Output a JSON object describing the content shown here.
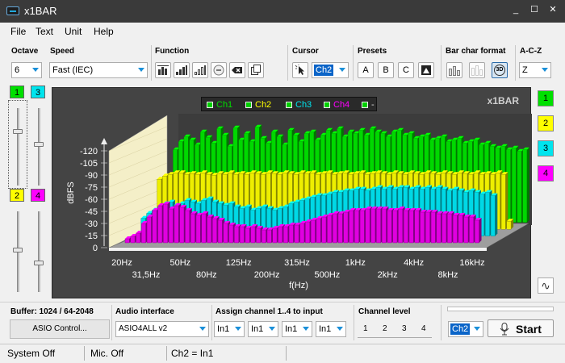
{
  "window": {
    "title": "x1BAR",
    "minimize": "_",
    "maximize": "☐",
    "close": "✕"
  },
  "menu": [
    "File",
    "Text",
    "Unit",
    "Help"
  ],
  "toolbar": {
    "octave": {
      "label": "Octave",
      "value": "6"
    },
    "speed": {
      "label": "Speed",
      "value": "Fast (IEC)"
    },
    "function": {
      "label": "Function",
      "buttons": [
        "peak-hold-icon",
        "bars-icon",
        "bars-outline-icon",
        "stop-icon",
        "clear-icon",
        "copy-icon"
      ]
    },
    "cursor": {
      "label": "Cursor",
      "value": "Ch2"
    },
    "presets": {
      "label": "Presets",
      "buttons": [
        "A",
        "B",
        "C"
      ]
    },
    "bar_format": {
      "label": "Bar char format",
      "view_3d": "3D"
    },
    "weighting": {
      "label": "A-C-Z",
      "value": "Z"
    }
  },
  "left_channels": [
    {
      "label": "1",
      "color": "#00e000"
    },
    {
      "label": "3",
      "color": "#00e5ee"
    },
    {
      "label": "2",
      "color": "#ffff00"
    },
    {
      "label": "4",
      "color": "#ff00ff"
    }
  ],
  "right_channels": [
    {
      "label": "1",
      "color": "#00e000"
    },
    {
      "label": "2",
      "color": "#ffff00"
    },
    {
      "label": "3",
      "color": "#00e5ee"
    },
    {
      "label": "4",
      "color": "#ff00ff"
    }
  ],
  "chart": {
    "brand": "x1BAR",
    "wave_icon": "∿"
  },
  "chart_data": {
    "type": "bar",
    "ylabel": "dBFS",
    "xlabel": "f(Hz)",
    "ylim": [
      -120,
      0
    ],
    "y_ticks": [
      0,
      -15,
      -30,
      -45,
      -60,
      -75,
      -90,
      -105,
      -120
    ],
    "x_ticks_row1": [
      "20Hz",
      "50Hz",
      "125Hz",
      "315Hz",
      "1kHz",
      "4kHz",
      "16kHz"
    ],
    "x_ticks_row2": [
      "31,5Hz",
      "80Hz",
      "200Hz",
      "500Hz",
      "2kHz",
      "8kHz"
    ],
    "legend": [
      {
        "name": "Ch1",
        "color": "#00e000"
      },
      {
        "name": "Ch2",
        "color": "#ffff00"
      },
      {
        "name": "Ch3",
        "color": "#00e5ee"
      },
      {
        "name": "Ch4",
        "color": "#ff00ff"
      },
      {
        "name": "-",
        "color": "#00e000"
      }
    ],
    "series": [
      {
        "name": "Ch1",
        "color": "#00d800",
        "values": [
          -30,
          -20,
          -14,
          -18,
          -24,
          -8,
          -15,
          -22,
          -4,
          -12,
          -26,
          -3,
          -18,
          -10,
          -20,
          -2,
          -16,
          -22,
          -8,
          -14,
          -24,
          -6,
          -12,
          -20,
          -10,
          -8,
          -18,
          -12,
          -6,
          -10,
          -4,
          -14,
          -8,
          -10,
          -6,
          -12,
          -4,
          -8,
          -10,
          -14,
          -8,
          -6,
          -12,
          -10,
          -16,
          -14,
          -12,
          -18,
          -16,
          -14,
          -20,
          -18,
          -16,
          -22,
          -20,
          -18,
          -24,
          -22,
          -26,
          -28,
          -26,
          -30,
          -28,
          -32,
          -30
        ]
      },
      {
        "name": "Ch2",
        "color": "#eeee00",
        "values": [
          -58,
          -54,
          -52,
          -50,
          -50,
          -52,
          -51,
          -52,
          -50,
          -52,
          -53,
          -51,
          -52,
          -50,
          -52,
          -51,
          -52,
          -50,
          -51,
          -52,
          -50,
          -51,
          -52,
          -50,
          -51,
          -52,
          -50,
          -51,
          -50,
          -52,
          -51,
          -50,
          -52,
          -51,
          -50,
          -52,
          -51,
          -50,
          -52,
          -51,
          -50,
          -51,
          -52,
          -50,
          -51,
          -52,
          -50,
          -51,
          -52,
          -50,
          -51,
          -52,
          -50,
          -51,
          -52,
          -50,
          -51,
          -52,
          -50,
          -52,
          -51,
          -52,
          -50,
          -52,
          -110
        ]
      },
      {
        "name": "Ch3",
        "color": "#00d8e6",
        "values": [
          -98,
          -92,
          -88,
          -84,
          -80,
          -78,
          -82,
          -80,
          -76,
          -78,
          -80,
          -76,
          -74,
          -78,
          -80,
          -82,
          -80,
          -84,
          -86,
          -84,
          -88,
          -86,
          -84,
          -86,
          -88,
          -86,
          -84,
          -80,
          -78,
          -76,
          -74,
          -72,
          -70,
          -70,
          -68,
          -66,
          -66,
          -64,
          -64,
          -62,
          -62,
          -64,
          -62,
          -60,
          -62,
          -60,
          -62,
          -60,
          -60,
          -62,
          -60,
          -62,
          -60,
          -62,
          -60,
          -62,
          -64,
          -62,
          -64,
          -66,
          -64,
          -66,
          -68,
          -66,
          -70
        ]
      },
      {
        "name": "Ch4",
        "color": "#e000e0",
        "values": [
          -115,
          -112,
          -108,
          -96,
          -88,
          -80,
          -74,
          -72,
          -78,
          -74,
          -76,
          -80,
          -84,
          -86,
          -84,
          -88,
          -90,
          -92,
          -96,
          -98,
          -100,
          -100,
          -102,
          -100,
          -102,
          -104,
          -104,
          -102,
          -100,
          -100,
          -98,
          -98,
          -96,
          -94,
          -92,
          -90,
          -88,
          -86,
          -84,
          -84,
          -82,
          -80,
          -80,
          -80,
          -78,
          -78,
          -78,
          -78,
          -80,
          -80,
          -78,
          -80,
          -80,
          -80,
          -82,
          -82,
          -82,
          -84,
          -84,
          -84,
          -86,
          -86,
          -88,
          -88,
          -92
        ]
      }
    ]
  },
  "bottom": {
    "buffer_label": "Buffer: 1024 / 64-2048",
    "asio_button": "ASIO Control...",
    "audio_interface_label": "Audio interface",
    "audio_interface_value": "ASIO4ALL v2",
    "assign_label": "Assign channel 1..4 to input",
    "inputs": [
      "In1",
      "In1",
      "In1",
      "In1"
    ],
    "channel_level_label": "Channel level",
    "levels": [
      "1",
      "2",
      "3",
      "4"
    ],
    "channel_select": "Ch2",
    "start": "Start"
  },
  "status": {
    "system": "System Off",
    "mic": "Mic. Off",
    "assignment": "Ch2 = In1"
  }
}
